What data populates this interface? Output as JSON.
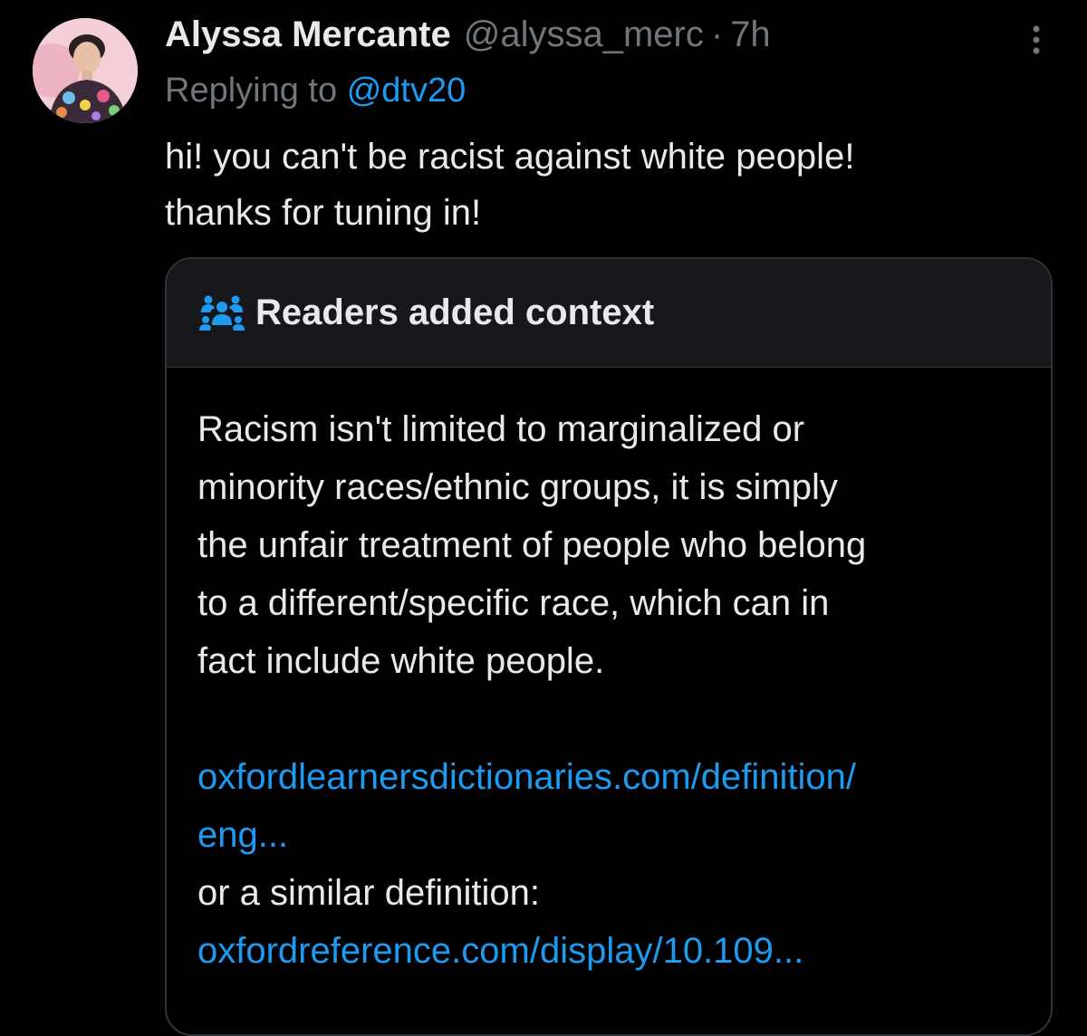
{
  "tweet": {
    "author_name": "Alyssa Mercante",
    "handle": "@alyssa_merc",
    "separator": "·",
    "time": "7h",
    "replying_to_label": "Replying to",
    "replying_to_handle": "@dtv20",
    "text_line_1": "hi! you can't be racist against white people!",
    "text_line_2": "thanks for tuning in!",
    "more_icon": "more-vertical-icon"
  },
  "community_note": {
    "title": "Readers added context",
    "icon": "people-icon",
    "body_lines": [
      "Racism isn't limited to marginalized or",
      "minority races/ethnic groups, it is simply",
      "the unfair treatment of people who belong",
      "to a different/specific race, which can in",
      "fact include white people."
    ],
    "link_1_line_1": "oxfordlearnersdictionaries.com/definition/",
    "link_1_line_2": "eng...",
    "secondary_text": "or a similar definition:",
    "link_2": "oxfordreference.com/display/10.109..."
  },
  "colors": {
    "background": "#000000",
    "primary_text": "#e7e9ea",
    "secondary_text": "#71767b",
    "link": "#1d9bf0",
    "note_header_bg": "#16181c",
    "note_border": "#2f3336"
  }
}
